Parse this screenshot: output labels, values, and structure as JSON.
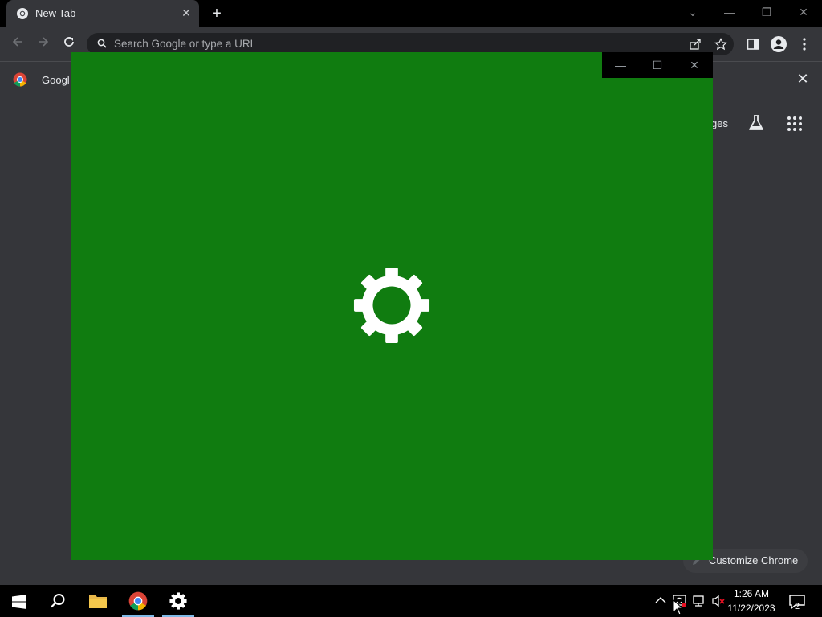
{
  "browser": {
    "tab": {
      "title": "New Tab",
      "close": "✕"
    },
    "new_tab": "+",
    "window_controls": {
      "minimize": "—",
      "restore": "❐",
      "close": "✕",
      "tab_search": "⌄"
    },
    "omnibox": {
      "placeholder": "Search Google or type a URL"
    },
    "bookmarks_bar": {
      "item": "Googl",
      "close": "✕"
    }
  },
  "ntp": {
    "images_link": "ges",
    "customize_label": "Customize Chrome"
  },
  "settings_splash": {
    "background_color": "#107c10",
    "controls": {
      "minimize": "—",
      "maximize": "☐",
      "close": "✕"
    }
  },
  "taskbar": {
    "time": "1:26 AM",
    "date": "11/22/2023",
    "notifications_count": "2"
  }
}
